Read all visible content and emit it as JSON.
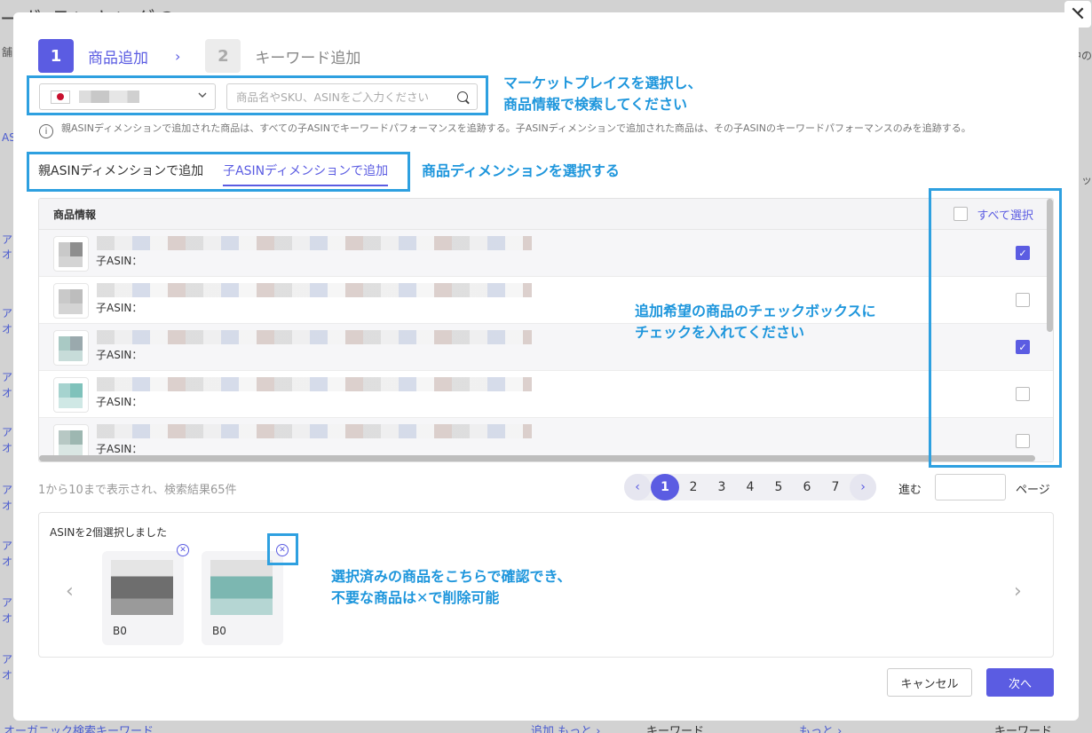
{
  "background": {
    "title": "ーボ ランキングの",
    "left_links": [
      "ア",
      "オ",
      "ASI",
      "ア",
      "オ",
      "ア",
      "オ",
      "ア",
      "オ",
      "ア",
      "オ",
      "ア",
      "オ",
      "ア",
      "オ",
      "ア",
      "オ"
    ],
    "right_edge": [
      "中の",
      "ッ"
    ],
    "left_edge": [
      "舗"
    ],
    "bottom": {
      "keyword_link": "オーガニック検索キーワード",
      "add_more": "追加 もっと ›",
      "keyword_1": "キーワード",
      "more": "もっと ›",
      "keyword_2": "キーワード"
    }
  },
  "close_icon": "✕",
  "steps": [
    {
      "num": "1",
      "label": "商品追加"
    },
    {
      "num": "2",
      "label": "キーワード追加"
    }
  ],
  "step_separator": "›",
  "search": {
    "placeholder": "商品名やSKU、ASINをご入力ください"
  },
  "info": {
    "icon": "i",
    "text": "親ASINディメンションで追加された商品は、すべての子ASINでキーワードパフォーマンスを追跡する。子ASINディメンションで追加された商品は、その子ASINのキーワードパフォーマンスのみを追跡する。"
  },
  "tabs": [
    {
      "label": "親ASINディメンションで追加",
      "active": false
    },
    {
      "label": "子ASINディメンションで追加",
      "active": true
    }
  ],
  "table": {
    "header_label": "商品情報",
    "select_all_label": "すべて選択",
    "rows": [
      {
        "asin_label": "子ASIN：",
        "checked": true
      },
      {
        "asin_label": "子ASIN：",
        "checked": false
      },
      {
        "asin_label": "子ASIN：",
        "checked": true
      },
      {
        "asin_label": "子ASIN：",
        "checked": false
      },
      {
        "asin_label": "子ASIN：",
        "checked": false
      }
    ]
  },
  "result_count": "1から10まで表示され、検索結果65件",
  "pagination": {
    "prev": "‹",
    "next": "›",
    "pages": [
      "1",
      "2",
      "3",
      "4",
      "5",
      "6",
      "7"
    ],
    "current": "1",
    "goto_label": "進む",
    "goto_suffix": "ページ"
  },
  "selected": {
    "title": "ASINを2個選択しました",
    "prev": "‹",
    "next": "›",
    "items": [
      {
        "code": "B0"
      },
      {
        "code": "B0"
      }
    ],
    "remove_icon": "✕"
  },
  "buttons": {
    "cancel": "キャンセル",
    "next": "次へ"
  },
  "annotations": {
    "search_line1": "マーケットプレイスを選択し、",
    "search_line2": "商品情報で検索してください",
    "dimension": "商品ディメンションを選択する",
    "checkbox_line1": "追加希望の商品のチェックボックスに",
    "checkbox_line2": "チェックを入れてください",
    "selected_line1": "選択済みの商品をこちらで確認でき、",
    "selected_line2": "不要な商品は✕で削除可能"
  },
  "colors": {
    "accent": "#5b5ce2",
    "annotation": "#1e96dc"
  }
}
